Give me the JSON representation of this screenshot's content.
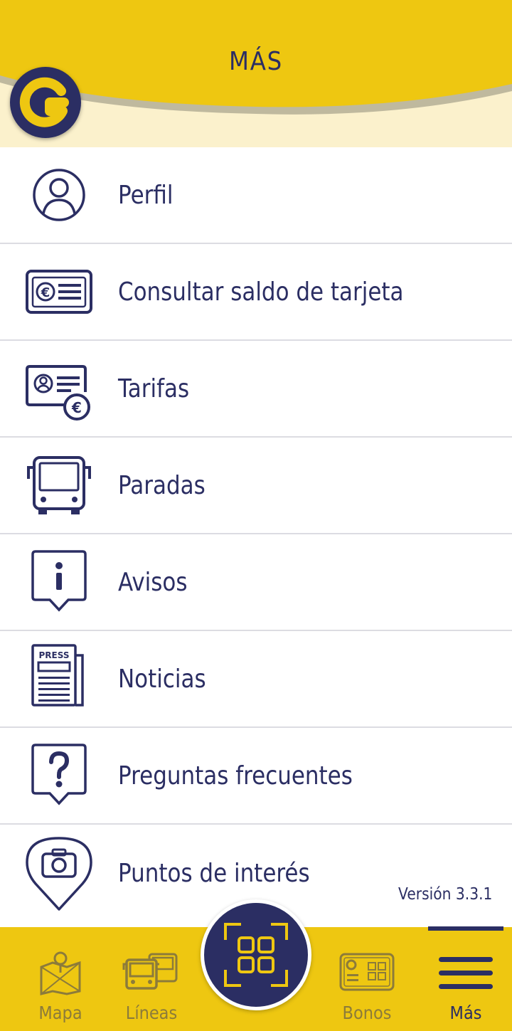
{
  "header": {
    "title": "MÁS"
  },
  "colors": {
    "brand_yellow": "#eec711",
    "navy": "#2b2e63",
    "header_bg": "#fbf1cc",
    "divider": "#dcdce2"
  },
  "menu": {
    "items": [
      {
        "label": "Perfil",
        "icon": "profile-icon"
      },
      {
        "label": "Consultar saldo de tarjeta",
        "icon": "card-balance-icon"
      },
      {
        "label": "Tarifas",
        "icon": "fares-icon"
      },
      {
        "label": "Paradas",
        "icon": "bus-stop-icon"
      },
      {
        "label": "Avisos",
        "icon": "info-bubble-icon"
      },
      {
        "label": "Noticias",
        "icon": "newspaper-icon",
        "icon_text": "PRESS"
      },
      {
        "label": "Preguntas frecuentes",
        "icon": "question-bubble-icon"
      },
      {
        "label": "Puntos de interés",
        "icon": "camera-pin-icon"
      }
    ]
  },
  "version": "Versión 3.3.1",
  "bottom_nav": {
    "tabs": [
      {
        "label": "Mapa",
        "icon": "map-icon",
        "active": false
      },
      {
        "label": "Líneas",
        "icon": "buses-icon",
        "active": false
      },
      {
        "label": "Bonos",
        "icon": "pass-card-icon",
        "active": false
      },
      {
        "label": "Más",
        "icon": "hamburger-menu-icon",
        "active": true
      }
    ],
    "center_button_icon": "qr-scan-icon"
  }
}
